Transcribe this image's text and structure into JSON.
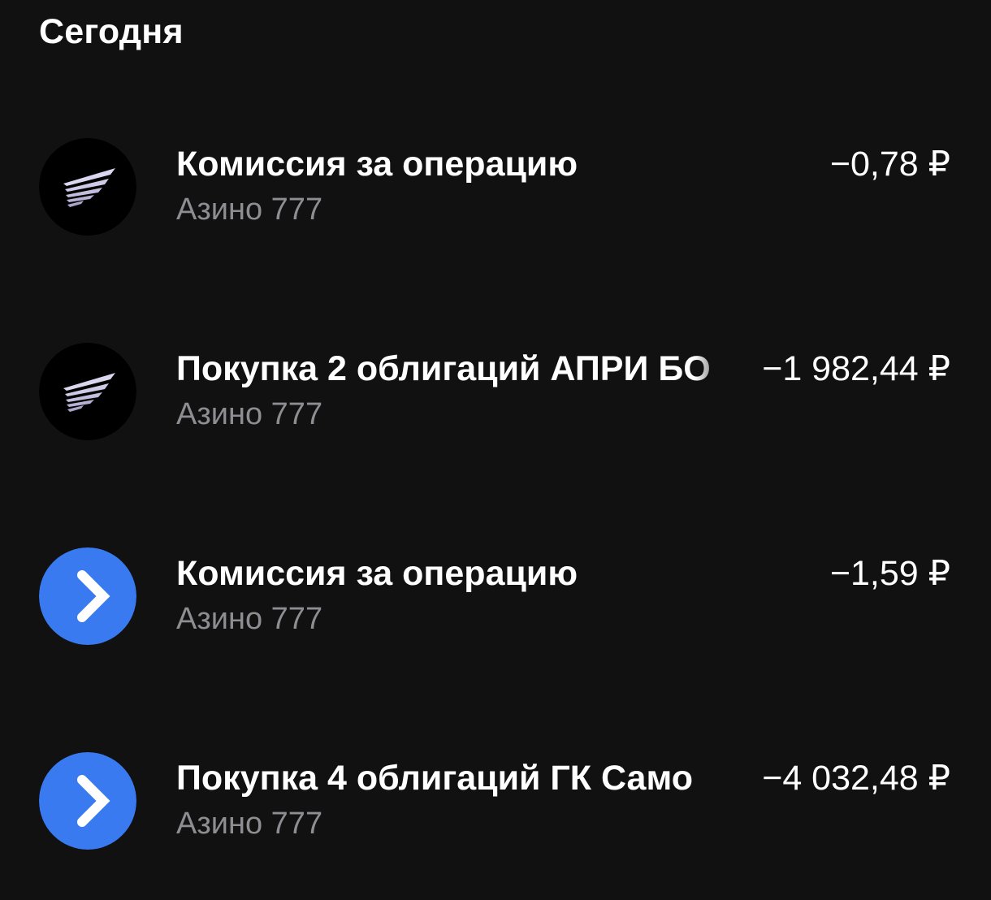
{
  "section": {
    "title": "Сегодня"
  },
  "operations": [
    {
      "title": "Комиссия за операцию",
      "subtitle": "Азино 777",
      "amount": "−0,78 ₽",
      "icon": "wing-logo-icon",
      "icon_bg": "#000000"
    },
    {
      "title": "Покупка 2 облигаций АПРИ БО",
      "subtitle": "Азино 777",
      "amount": "−1 982,44 ₽",
      "icon": "wing-logo-icon",
      "icon_bg": "#000000"
    },
    {
      "title": "Комиссия за операцию",
      "subtitle": "Азино 777",
      "amount": "−1,59 ₽",
      "icon": "chevron-right-logo-icon",
      "icon_bg": "#3a7af0"
    },
    {
      "title": "Покупка 4 облигаций ГК Само",
      "subtitle": "Азино 777",
      "amount": "−4 032,48 ₽",
      "icon": "chevron-right-logo-icon",
      "icon_bg": "#3a7af0"
    }
  ]
}
